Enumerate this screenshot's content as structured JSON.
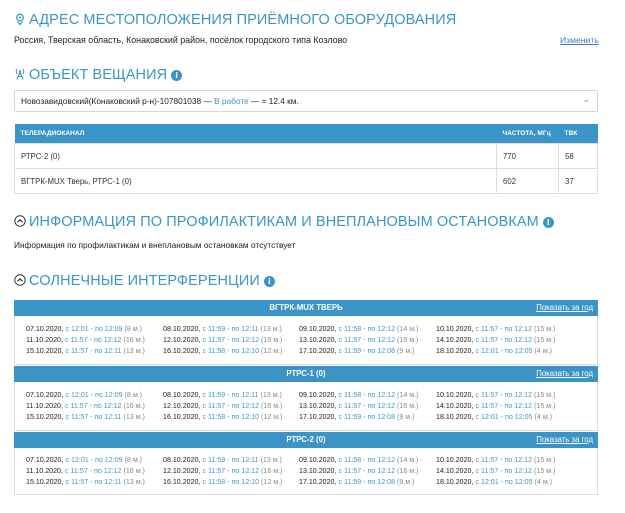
{
  "location": {
    "title": "АДРЕС МЕСТОПОЛОЖЕНИЯ ПРИЁМНОГО ОБОРУДОВАНИЯ",
    "address": "Россия, Тверская область, Конаковский район, посёлок городского типа Козлово",
    "change_link": "Изменить"
  },
  "broadcast": {
    "title": "ОБЪЕКТ ВЕЩАНИЯ",
    "selected_prefix": "Новозавидовский(Конаковский р-н)-107801038 —",
    "selected_status": "В работе",
    "selected_suffix": "— = 12.4 км.",
    "table": {
      "headers": [
        "ТЕЛЕРАДИОКАНАЛ",
        "ЧАСТОТА, МГц",
        "ТВК"
      ],
      "rows": [
        [
          "РТРС-2 (0)",
          "770",
          "58"
        ],
        [
          "ВГТРК-MUX Тверь, РТРС-1 (0)",
          "602",
          "37"
        ]
      ]
    }
  },
  "maintenance": {
    "title": "ИНФОРМАЦИЯ ПО ПРОФИЛАКТИКАМ И ВНЕПЛАНОВЫМ ОСТАНОВКАМ",
    "text": "Информация по профилактикам и внеплановым остановкам отсутствует"
  },
  "solar": {
    "title": "СОЛНЕЧНЫЕ ИНТЕРФЕРЕНЦИИ",
    "show_year_label": "Показать за год",
    "groups": [
      {
        "name": "ВГТРК-MUX ТВЕРЬ",
        "rows": [
          [
            {
              "date": "07.10.2020,",
              "time": "с 12:01 - по 12:09",
              "dur": "(8 м.)"
            },
            {
              "date": "08.10.2020,",
              "time": "с 11:59 - по 12:11",
              "dur": "(13 м.)"
            },
            {
              "date": "09.10.2020,",
              "time": "с 11:58 - по 12:12",
              "dur": "(14 м.)"
            },
            {
              "date": "10.10.2020,",
              "time": "с 11:57 - по 12:12",
              "dur": "(15 м.)"
            }
          ],
          [
            {
              "date": "11.10.2020,",
              "time": "с 11:57 - по 12:12",
              "dur": "(16 м.)"
            },
            {
              "date": "12.10.2020,",
              "time": "с 11:57 - по 12:12",
              "dur": "(16 м.)"
            },
            {
              "date": "13.10.2020,",
              "time": "с 11:57 - по 12:12",
              "dur": "(16 м.)"
            },
            {
              "date": "14.10.2020,",
              "time": "с 11:57 - по 12:12",
              "dur": "(15 м.)"
            }
          ],
          [
            {
              "date": "15.10.2020,",
              "time": "с 11:57 - по 12:11",
              "dur": "(13 м.)"
            },
            {
              "date": "16.10.2020,",
              "time": "с 11:58 - по 12:10",
              "dur": "(12 м.)"
            },
            {
              "date": "17.10.2020,",
              "time": "с 11:59 - по 12:08",
              "dur": "(9 м.)"
            },
            {
              "date": "18.10.2020,",
              "time": "с 12:01 - по 12:05",
              "dur": "(4 м.)"
            }
          ]
        ]
      },
      {
        "name": "РТРС-1 (0)",
        "rows": [
          [
            {
              "date": "07.10.2020,",
              "time": "с 12:01 - по 12:09",
              "dur": "(8 м.)"
            },
            {
              "date": "08.10.2020,",
              "time": "с 11:59 - по 12:11",
              "dur": "(13 м.)"
            },
            {
              "date": "09.10.2020,",
              "time": "с 11:58 - по 12:12",
              "dur": "(14 м.)"
            },
            {
              "date": "10.10.2020,",
              "time": "с 11:57 - по 12:12",
              "dur": "(15 м.)"
            }
          ],
          [
            {
              "date": "11.10.2020,",
              "time": "с 11:57 - по 12:12",
              "dur": "(16 м.)"
            },
            {
              "date": "12.10.2020,",
              "time": "с 11:57 - по 12:12",
              "dur": "(16 м.)"
            },
            {
              "date": "13.10.2020,",
              "time": "с 11:57 - по 12:12",
              "dur": "(16 м.)"
            },
            {
              "date": "14.10.2020,",
              "time": "с 11:57 - по 12:12",
              "dur": "(15 м.)"
            }
          ],
          [
            {
              "date": "15.10.2020,",
              "time": "с 11:57 - по 12:11",
              "dur": "(13 м.)"
            },
            {
              "date": "16.10.2020,",
              "time": "с 11:58 - по 12:10",
              "dur": "(12 м.)"
            },
            {
              "date": "17.10.2020,",
              "time": "с 11:59 - по 12:08",
              "dur": "(9 м.)"
            },
            {
              "date": "18.10.2020,",
              "time": "с 12:01 - по 12:05",
              "dur": "(4 м.)"
            }
          ]
        ]
      },
      {
        "name": "РТРС-2 (0)",
        "rows": [
          [
            {
              "date": "07.10.2020,",
              "time": "с 12:01 - по 12:09",
              "dur": "(8 м.)"
            },
            {
              "date": "08.10.2020,",
              "time": "с 11:59 - по 12:11",
              "dur": "(13 м.)"
            },
            {
              "date": "09.10.2020,",
              "time": "с 11:58 - по 12:12",
              "dur": "(14 м.)"
            },
            {
              "date": "10.10.2020,",
              "time": "с 11:57 - по 12:12",
              "dur": "(15 м.)"
            }
          ],
          [
            {
              "date": "11.10.2020,",
              "time": "с 11:57 - по 12:12",
              "dur": "(16 м.)"
            },
            {
              "date": "12.10.2020,",
              "time": "с 11:57 - по 12:12",
              "dur": "(16 м.)"
            },
            {
              "date": "13.10.2020,",
              "time": "с 11:57 - по 12:12",
              "dur": "(16 м.)"
            },
            {
              "date": "14.10.2020,",
              "time": "с 11:57 - по 12:12",
              "dur": "(15 м.)"
            }
          ],
          [
            {
              "date": "15.10.2020,",
              "time": "с 11:57 - по 12:11",
              "dur": "(13 м.)"
            },
            {
              "date": "16.10.2020,",
              "time": "с 11:58 - по 12:10",
              "dur": "(12 м.)"
            },
            {
              "date": "17.10.2020,",
              "time": "с 11:59 - по 12:08",
              "dur": "(9 м.)"
            },
            {
              "date": "18.10.2020,",
              "time": "с 12:01 - по 12:05",
              "dur": "(4 м.)"
            }
          ]
        ]
      }
    ]
  },
  "colors": {
    "accent": "#3a95c6",
    "link": "#3e78c9"
  },
  "icons": {
    "location": "location-pin-icon",
    "broadcast": "antenna-icon",
    "collapse": "collapse-chevron-icon",
    "info": "info-icon"
  }
}
